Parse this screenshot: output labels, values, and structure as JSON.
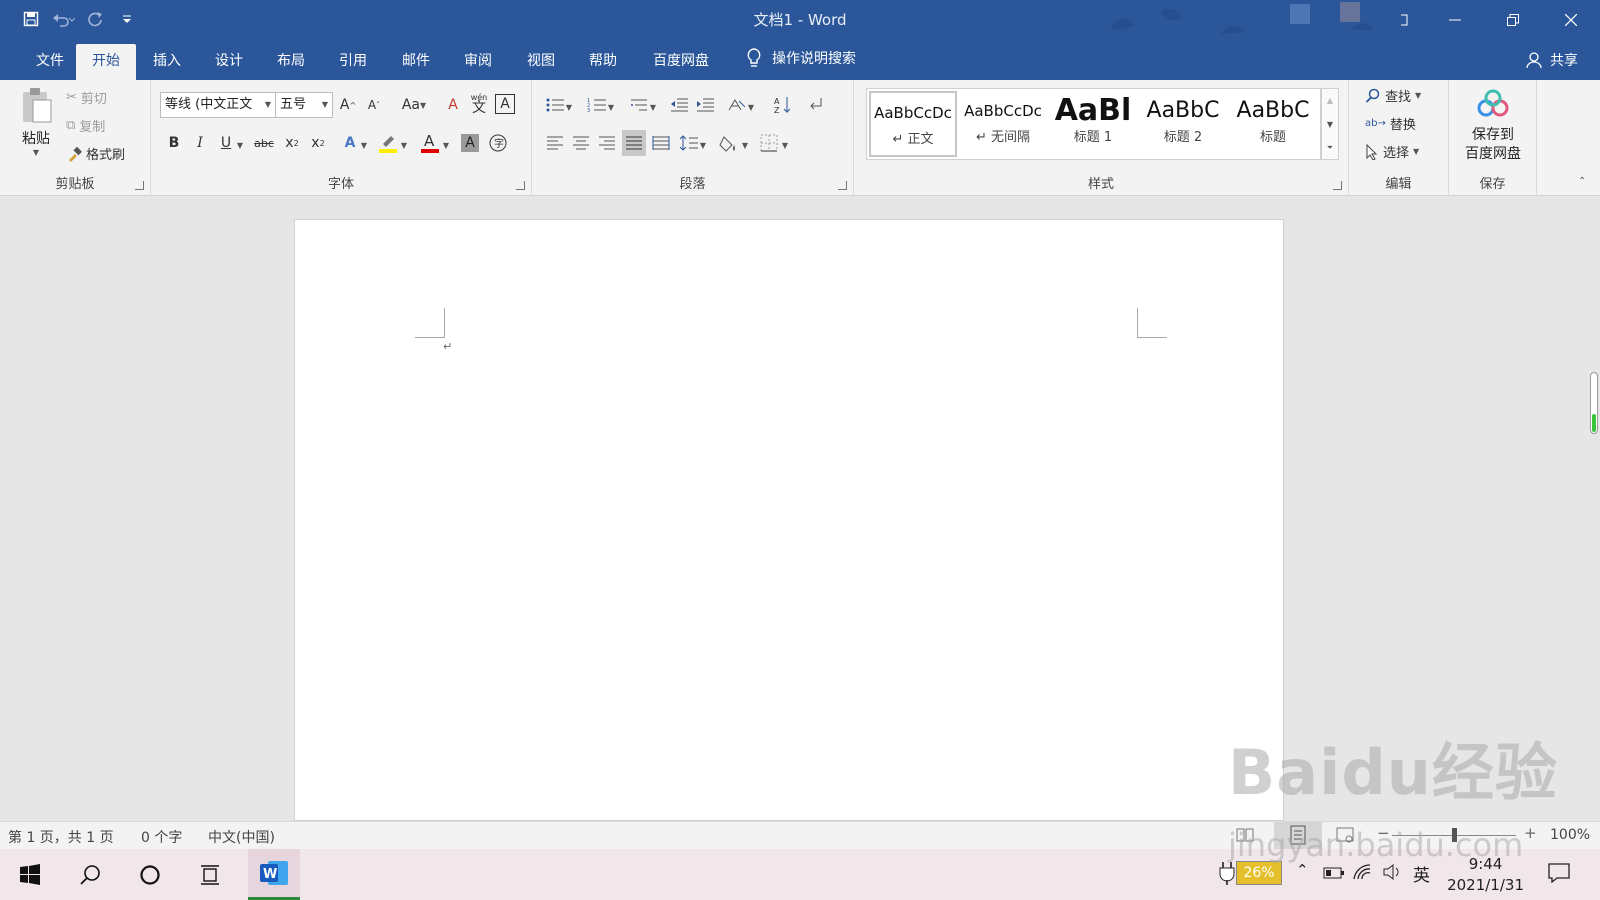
{
  "window": {
    "title": "文档1  -  Word"
  },
  "tabs": [
    "文件",
    "开始",
    "插入",
    "设计",
    "布局",
    "引用",
    "邮件",
    "审阅",
    "视图",
    "帮助",
    "百度网盘"
  ],
  "active_tab": "开始",
  "tell_me": "操作说明搜索",
  "share": "共享",
  "clipboard": {
    "paste": "粘贴",
    "cut": "剪切",
    "copy": "复制",
    "format_painter": "格式刷",
    "label": "剪贴板"
  },
  "font": {
    "font_name": "等线 (中文正文",
    "font_size": "五号",
    "wen_glyph": "文",
    "wen_pinyin": "wén",
    "label": "字体",
    "text_color": "#e00000",
    "highlight_color": "#ffee00"
  },
  "paragraph": {
    "label": "段落"
  },
  "styles": {
    "label": "样式",
    "items": [
      {
        "sample": "AaBbCcDc",
        "name": "↵ 正文"
      },
      {
        "sample": "AaBbCcDc",
        "name": "↵ 无间隔"
      },
      {
        "sample": "AaBl",
        "name": "标题 1"
      },
      {
        "sample": "AaBbC",
        "name": "标题 2"
      },
      {
        "sample": "AaBbC",
        "name": "标题"
      }
    ]
  },
  "editing": {
    "label": "编辑",
    "find": "查找",
    "replace": "替换",
    "select": "选择"
  },
  "save": {
    "label": "保存",
    "button_line1": "保存到",
    "button_line2": "百度网盘"
  },
  "document": {
    "paragraph_mark": "↵"
  },
  "status": {
    "page": "第 1 页，共 1 页",
    "words": "0 个字",
    "language": "中文(中国)",
    "zoom": "100%"
  },
  "taskbar": {
    "battery": "26%",
    "ime": "英",
    "time": "9:44",
    "date": "2021/1/31"
  },
  "watermark": {
    "brand": "Baidu经验",
    "url": "jingyan.baidu.com"
  },
  "colors": {
    "word_blue": "#2b579a",
    "ribbon_bg": "#f3f3f3",
    "taskbar_bg": "#f1e6ea"
  }
}
